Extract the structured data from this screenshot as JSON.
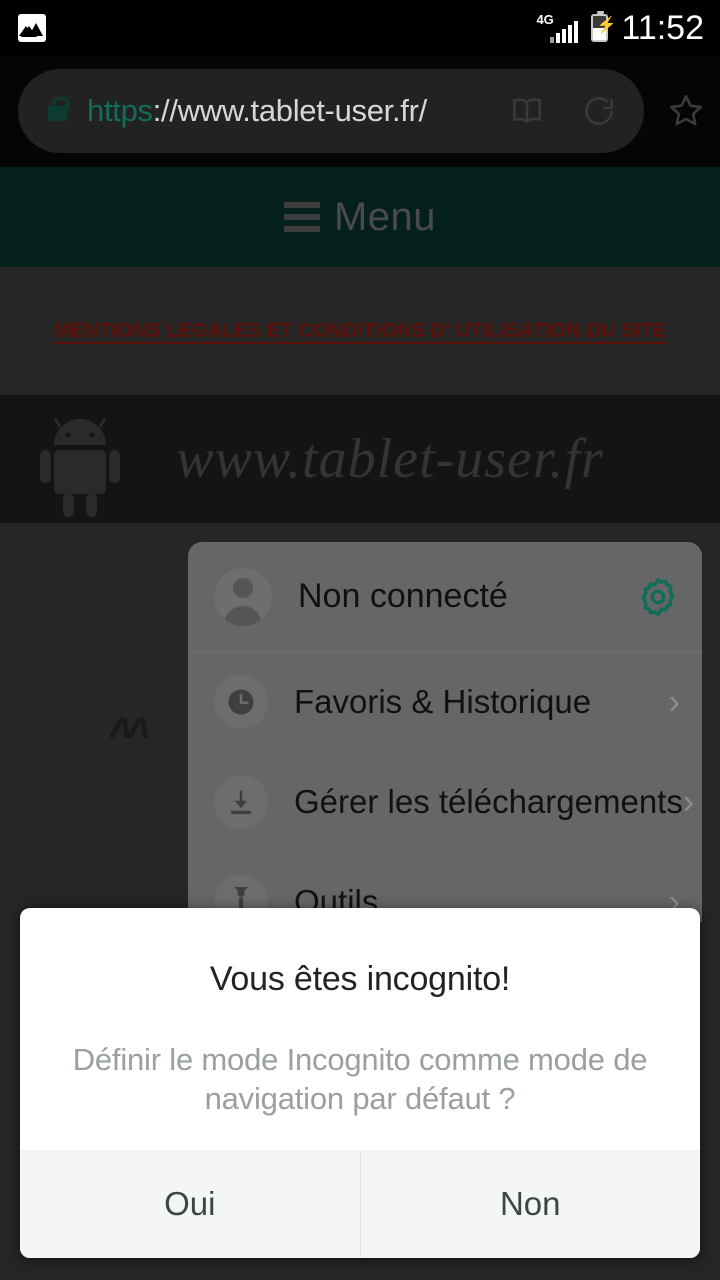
{
  "statusbar": {
    "image_icon": "image-icon",
    "network_label": "4G",
    "battery_icon": "battery-charging-icon",
    "time": "11:52"
  },
  "browser": {
    "url_scheme": "https",
    "url_rest": "://www.tablet-user.fr/",
    "lock_icon": "lock-icon",
    "reader_icon": "reader-mode-icon",
    "reload_icon": "reload-icon",
    "bookmark_icon": "star-icon"
  },
  "webpage": {
    "site_menu_label": "Menu",
    "hamburger_icon": "hamburger-icon",
    "legal_link": "MENTIONS LEGALES ET CONDITIONS D' UTILISATION DU SITE",
    "banner_text": "www.tablet-user.fr",
    "android_icon": "android-robot-icon"
  },
  "menu_panel": {
    "account": {
      "label": "Non connecté",
      "avatar_icon": "avatar-icon",
      "settings_icon": "gear-icon"
    },
    "items": [
      {
        "label": "Favoris & Historique",
        "icon": "clock-icon",
        "chevron": "›"
      },
      {
        "label": "Gérer les téléchargements",
        "icon": "download-icon",
        "chevron": "›"
      },
      {
        "label": "Outils",
        "icon": "wrench-icon",
        "chevron": "›"
      }
    ]
  },
  "dialog": {
    "title": "Vous êtes incognito!",
    "message": "Définir le mode Incognito comme mode de navigation par défaut ?",
    "confirm_label": "Oui",
    "dismiss_label": "Non"
  },
  "colors": {
    "accent_teal": "#0f6d58",
    "site_header": "#04201d",
    "legal_red": "#5c1008",
    "page_bg": "#262626",
    "panel_gray": "#666666"
  }
}
